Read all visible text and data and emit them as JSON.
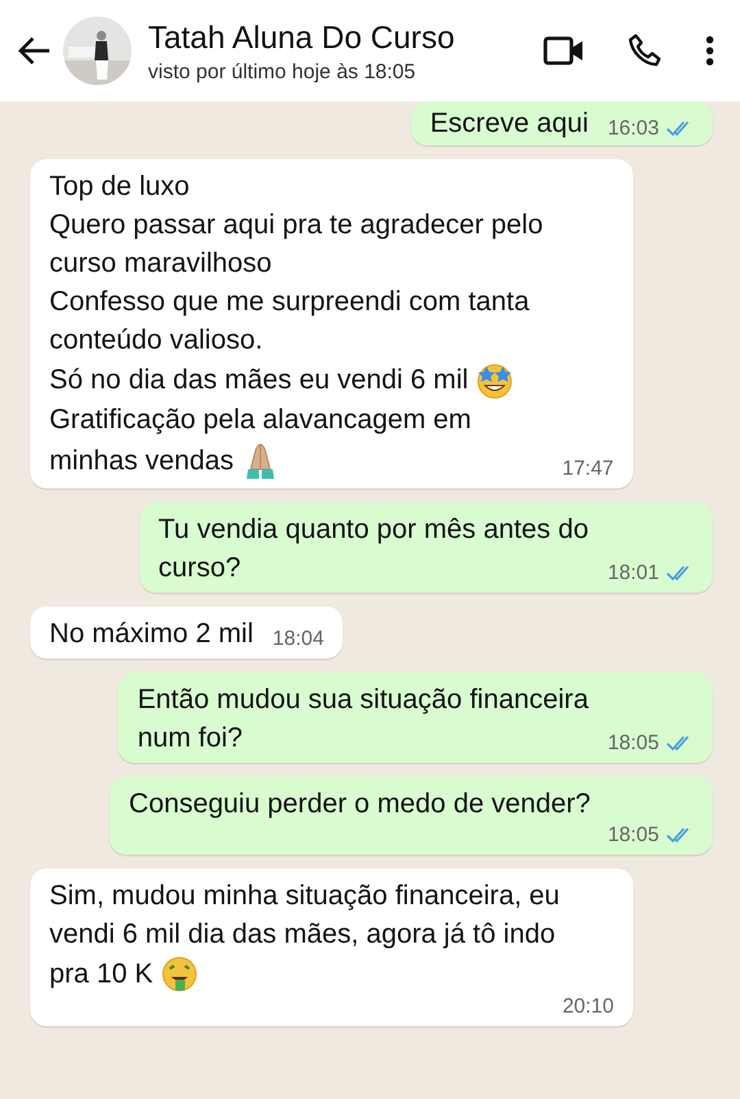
{
  "header": {
    "contact_name": "Tatah Aluna Do Curso",
    "status": "visto por último hoje às 18:05"
  },
  "messages": [
    {
      "kind": "sent",
      "lines": [
        {
          "text": "Escreve aqui"
        }
      ],
      "time": "16:03",
      "read": true
    },
    {
      "kind": "received",
      "lines": [
        {
          "text": "Top de luxo"
        },
        {
          "text": "Quero passar aqui pra te agradecer pelo"
        },
        {
          "text": "curso maravilhoso"
        },
        {
          "text": "Confesso que me surpreendi com tanta"
        },
        {
          "text": "conteúdo valioso."
        },
        {
          "text": "Só no dia das mães eu vendi 6 mil",
          "kind": "stareyes"
        },
        {
          "text": "Gratificação pela alavancagem em"
        },
        {
          "text": "minhas vendas",
          "kind": "prayer"
        }
      ],
      "time": "17:47"
    },
    {
      "kind": "sent",
      "lines": [
        {
          "text": "Tu vendia quanto por mês antes do"
        },
        {
          "text": "curso?"
        }
      ],
      "time": "18:01",
      "read": true
    },
    {
      "kind": "received",
      "lines": [
        {
          "text": "No máximo 2 mil"
        }
      ],
      "time": "18:04"
    },
    {
      "kind": "sent",
      "lines": [
        {
          "text": "Então mudou sua situação financeira"
        },
        {
          "text": "num foi?"
        }
      ],
      "time": "18:05",
      "read": true
    },
    {
      "kind": "sent",
      "lines": [
        {
          "text": "Conseguiu perder o medo de vender?"
        }
      ],
      "time": "18:05",
      "read": true
    },
    {
      "kind": "received",
      "lines": [
        {
          "text": "Sim, mudou minha situação financeira, eu"
        },
        {
          "text": "vendi 6 mil dia das mães, agora já tô indo"
        },
        {
          "text": "pra 10 K",
          "kind": "moneyface"
        }
      ],
      "time": "20:10"
    }
  ]
}
